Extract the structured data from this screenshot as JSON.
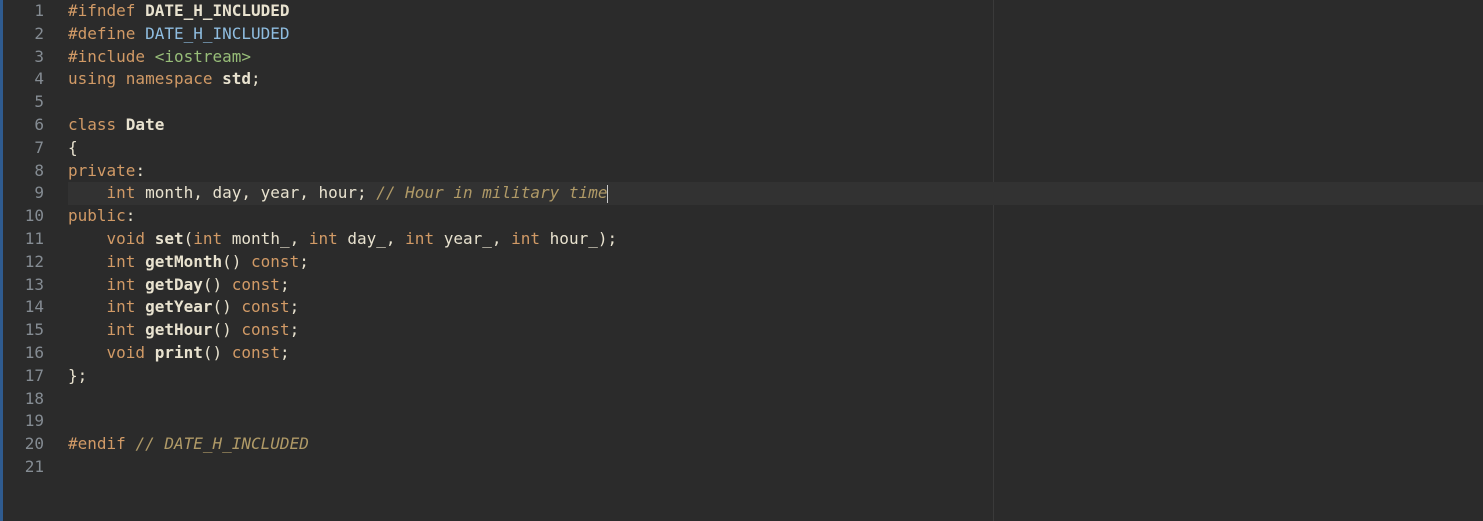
{
  "editor": {
    "cursor_line": 9,
    "line_count": 21,
    "lines": [
      {
        "n": 1,
        "tokens": [
          [
            "pp",
            "#ifndef "
          ],
          [
            "macro",
            "DATE_H_INCLUDED"
          ]
        ]
      },
      {
        "n": 2,
        "tokens": [
          [
            "pp",
            "#define "
          ],
          [
            "macro2",
            "DATE_H_INCLUDED"
          ]
        ]
      },
      {
        "n": 3,
        "tokens": [
          [
            "pp",
            "#include "
          ],
          [
            "angle",
            "<iostream>"
          ]
        ]
      },
      {
        "n": 4,
        "tokens": [
          [
            "kw",
            "using "
          ],
          [
            "kw",
            "namespace "
          ],
          [
            "ident",
            "std"
          ],
          [
            "punct",
            ";"
          ]
        ]
      },
      {
        "n": 5,
        "tokens": []
      },
      {
        "n": 6,
        "tokens": [
          [
            "kw",
            "class "
          ],
          [
            "ident",
            "Date"
          ]
        ]
      },
      {
        "n": 7,
        "tokens": [
          [
            "punct",
            "{"
          ]
        ]
      },
      {
        "n": 8,
        "tokens": [
          [
            "kw",
            "private"
          ],
          [
            "punct",
            ":"
          ]
        ]
      },
      {
        "n": 9,
        "tokens": [
          [
            "plain",
            "    "
          ],
          [
            "kw",
            "int "
          ],
          [
            "plain",
            "month"
          ],
          [
            "punct",
            ", "
          ],
          [
            "plain",
            "day"
          ],
          [
            "punct",
            ", "
          ],
          [
            "plain",
            "year"
          ],
          [
            "punct",
            ", "
          ],
          [
            "plain",
            "hour"
          ],
          [
            "punct",
            "; "
          ],
          [
            "comment",
            "// Hour in military time"
          ]
        ],
        "cursor_after": true
      },
      {
        "n": 10,
        "tokens": [
          [
            "kw",
            "public"
          ],
          [
            "punct",
            ":"
          ]
        ]
      },
      {
        "n": 11,
        "tokens": [
          [
            "plain",
            "    "
          ],
          [
            "kw",
            "void "
          ],
          [
            "ident",
            "set"
          ],
          [
            "punct",
            "("
          ],
          [
            "kw",
            "int "
          ],
          [
            "plain",
            "month_"
          ],
          [
            "punct",
            ", "
          ],
          [
            "kw",
            "int "
          ],
          [
            "plain",
            "day_"
          ],
          [
            "punct",
            ", "
          ],
          [
            "kw",
            "int "
          ],
          [
            "plain",
            "year_"
          ],
          [
            "punct",
            ", "
          ],
          [
            "kw",
            "int "
          ],
          [
            "plain",
            "hour_"
          ],
          [
            "punct",
            ");"
          ]
        ]
      },
      {
        "n": 12,
        "tokens": [
          [
            "plain",
            "    "
          ],
          [
            "kw",
            "int "
          ],
          [
            "ident",
            "getMonth"
          ],
          [
            "punct",
            "() "
          ],
          [
            "kw",
            "const"
          ],
          [
            "punct",
            ";"
          ]
        ]
      },
      {
        "n": 13,
        "tokens": [
          [
            "plain",
            "    "
          ],
          [
            "kw",
            "int "
          ],
          [
            "ident",
            "getDay"
          ],
          [
            "punct",
            "() "
          ],
          [
            "kw",
            "const"
          ],
          [
            "punct",
            ";"
          ]
        ]
      },
      {
        "n": 14,
        "tokens": [
          [
            "plain",
            "    "
          ],
          [
            "kw",
            "int "
          ],
          [
            "ident",
            "getYear"
          ],
          [
            "punct",
            "() "
          ],
          [
            "kw",
            "const"
          ],
          [
            "punct",
            ";"
          ]
        ]
      },
      {
        "n": 15,
        "tokens": [
          [
            "plain",
            "    "
          ],
          [
            "kw",
            "int "
          ],
          [
            "ident",
            "getHour"
          ],
          [
            "punct",
            "() "
          ],
          [
            "kw",
            "const"
          ],
          [
            "punct",
            ";"
          ]
        ]
      },
      {
        "n": 16,
        "tokens": [
          [
            "plain",
            "    "
          ],
          [
            "kw",
            "void "
          ],
          [
            "ident",
            "print"
          ],
          [
            "punct",
            "() "
          ],
          [
            "kw",
            "const"
          ],
          [
            "punct",
            ";"
          ]
        ]
      },
      {
        "n": 17,
        "tokens": [
          [
            "punct",
            "};"
          ]
        ]
      },
      {
        "n": 18,
        "tokens": []
      },
      {
        "n": 19,
        "tokens": []
      },
      {
        "n": 20,
        "tokens": [
          [
            "pp",
            "#endif "
          ],
          [
            "comment",
            "// DATE_H_INCLUDED"
          ]
        ]
      },
      {
        "n": 21,
        "tokens": []
      }
    ]
  },
  "token_classes": {
    "pp": "tok-pp",
    "macro": "tok-macro",
    "macro2": "tok-macro2",
    "angle": "tok-angle",
    "kw": "tok-kw",
    "ident": "tok-ident",
    "plain": "tok-plain",
    "punct": "tok-punct",
    "comment": "tok-comment"
  }
}
